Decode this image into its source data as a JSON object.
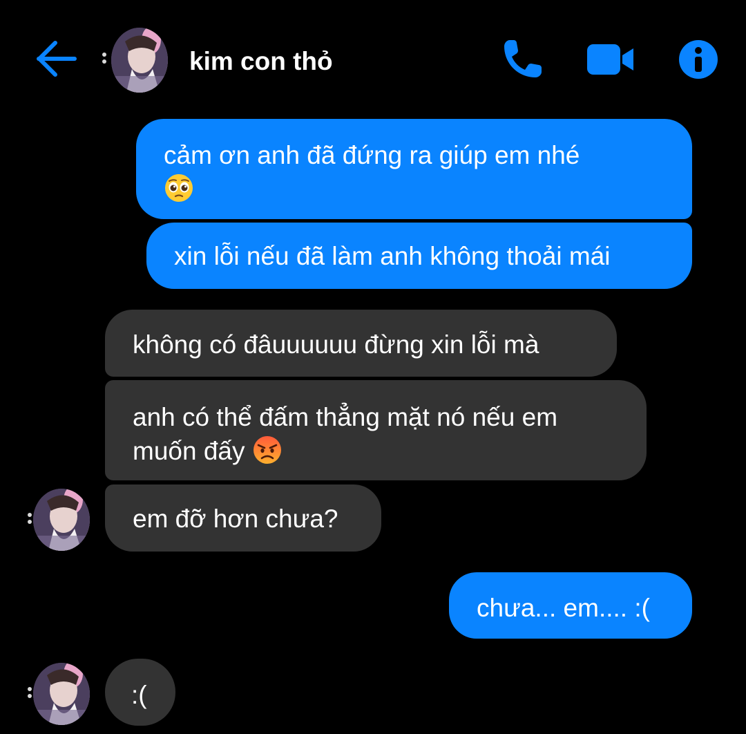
{
  "header": {
    "contact_name": "kim con thỏ",
    "back_icon": "arrow-left-icon",
    "call_icon": "phone-icon",
    "video_icon": "video-camera-icon",
    "info_icon": "info-icon"
  },
  "colors": {
    "accent": "#0a84ff",
    "outgoing_bubble": "#0a84ff",
    "incoming_bubble": "#333333",
    "background": "#000000"
  },
  "messages": [
    {
      "direction": "outgoing",
      "text": "cảm ơn anh đã đứng ra giúp em nhé",
      "emoji": "pleading-face"
    },
    {
      "direction": "outgoing",
      "text": "xin lỗi nếu đã làm anh không thoải mái"
    },
    {
      "direction": "incoming",
      "text": "không có đâuuuuuu đừng xin lỗi mà"
    },
    {
      "direction": "incoming",
      "text": "anh có thể đấm thẳng mặt nó nếu em muốn đấy",
      "emoji": "angry-face"
    },
    {
      "direction": "incoming",
      "text": "em đỡ hơn chưa?"
    },
    {
      "direction": "outgoing",
      "text": "chưa... em.... :("
    },
    {
      "direction": "incoming",
      "text": ":("
    }
  ]
}
